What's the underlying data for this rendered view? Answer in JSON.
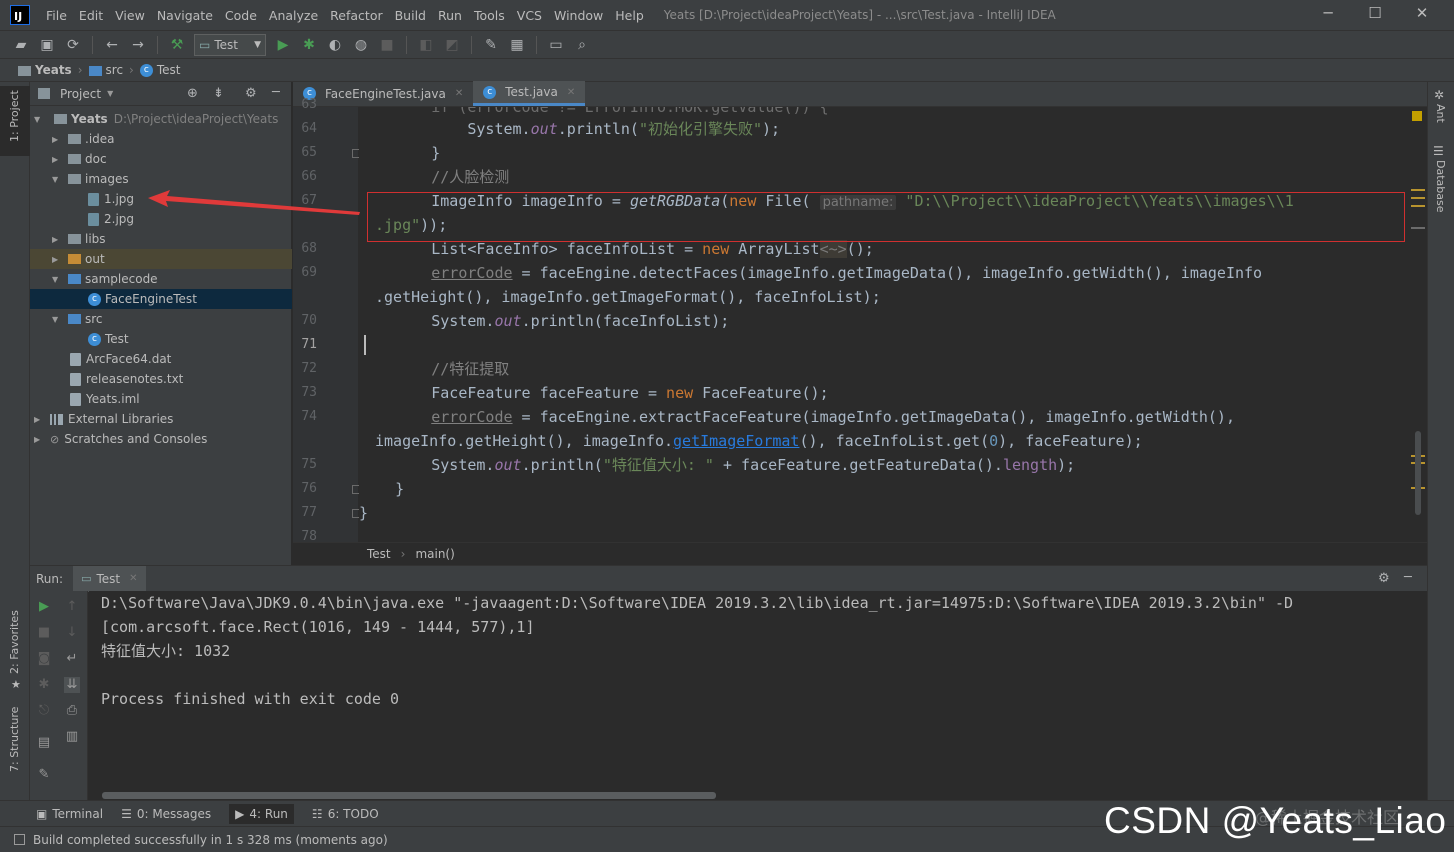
{
  "menubar": {
    "logo": "IJ",
    "items": [
      "File",
      "Edit",
      "View",
      "Navigate",
      "Code",
      "Analyze",
      "Refactor",
      "Build",
      "Run",
      "Tools",
      "VCS",
      "Window",
      "Help"
    ],
    "title": "Yeats [D:\\Project\\ideaProject\\Yeats] - ...\\src\\Test.java - IntelliJ IDEA",
    "minimize": "─",
    "maximize": "☐",
    "close": "✕"
  },
  "toolbar": {
    "run_config": "Test"
  },
  "breadcrumb": {
    "project": "Yeats",
    "folder": "src",
    "file": "Test"
  },
  "left_strip": {
    "project": "1: Project",
    "favorites": "2: Favorites",
    "structure": "7: Structure"
  },
  "right_strip": {
    "ant": "Ant",
    "database": "Database"
  },
  "project_panel": {
    "title": "Project",
    "root_name": "Yeats",
    "root_path": "D:\\Project\\ideaProject\\Yeats",
    "tree": {
      "idea": ".idea",
      "doc": "doc",
      "images": "images",
      "img1": "1.jpg",
      "img2": "2.jpg",
      "libs": "libs",
      "out": "out",
      "samplecode": "samplecode",
      "face_engine_test": "FaceEngineTest",
      "src": "src",
      "test": "Test",
      "arcface": "ArcFace64.dat",
      "release": "releasenotes.txt",
      "iml": "Yeats.iml",
      "ext_libs": "External Libraries",
      "scratches": "Scratches and Consoles"
    }
  },
  "editor": {
    "tabs": [
      "FaceEngineTest.java",
      "Test.java"
    ],
    "line_numbers": [
      "63",
      "64",
      "65",
      "66",
      "67",
      "68",
      "69",
      "70",
      "71",
      "72",
      "73",
      "74",
      "75",
      "76",
      "77",
      "78"
    ],
    "code": {
      "l64_a": "            System.",
      "l64_field": "out",
      "l64_b": ".println(",
      "l64_str": "\"初始化引擎失败\"",
      "l64_c": ");",
      "l65": "        }",
      "l66": "        //人脸检测",
      "l67_a": "        ImageInfo imageInfo = ",
      "l67_method": "getRGBData",
      "l67_kw": "new",
      "l67_b": " File( ",
      "l67_hint": "pathname:",
      "l67_str": " \"D:\\\\Project\\\\ideaProject\\\\Yeats\\\\images\\\\1",
      "l67_cont_str": ".jpg\"",
      "l67_cont": "));",
      "l68_a": "        List<FaceInfo> faceInfoList = ",
      "l68_kw": "new",
      "l68_b": " ArrayList",
      "l68_diamond": "<~>",
      "l68_c": "();",
      "l69_a": "        ",
      "l69_err": "errorCode",
      "l69_b": " = faceEngine.detectFaces(imageInfo.getImageData(), imageInfo.getWidth(), imageInfo",
      "l69_cont": ".getHeight(), imageInfo.getImageFormat(), faceInfoList);",
      "l70_a": "        System.",
      "l70_field": "out",
      "l70_b": ".println(faceInfoList);",
      "l72": "        //特征提取",
      "l73_a": "        FaceFeature faceFeature = ",
      "l73_kw": "new",
      "l73_b": " FaceFeature();",
      "l74_a": "        ",
      "l74_err": "errorCode",
      "l74_b": " = faceEngine.extractFaceFeature(imageInfo.getImageData(), imageInfo.getWidth(),",
      "l74_cont_a": "imageInfo.getHeight(), imageInfo.",
      "l74_link": "getImageFormat",
      "l74_cont_b": "(), faceInfoList.get(",
      "l74_num": "0",
      "l74_cont_c": "), faceFeature);",
      "l75_a": "        System.",
      "l75_field": "out",
      "l75_b": ".println(",
      "l75_str": "\"特征值大小: \"",
      "l75_c": " + faceFeature.getFeatureData().",
      "l75_len": "length",
      "l75_d": ");",
      "l76": "    }",
      "l77": "}"
    },
    "breadcrumb": [
      "Test",
      "main()"
    ]
  },
  "run_panel": {
    "label": "Run:",
    "tab": "Test",
    "console": [
      "D:\\Software\\Java\\JDK9.0.4\\bin\\java.exe \"-javaagent:D:\\Software\\IDEA 2019.3.2\\lib\\idea_rt.jar=14975:D:\\Software\\IDEA 2019.3.2\\bin\" -D",
      "[com.arcsoft.face.Rect(1016, 149 - 1444, 577),1]",
      "特征值大小: 1032",
      "",
      "Process finished with exit code 0"
    ]
  },
  "bottom_bar": {
    "terminal": "Terminal",
    "messages": "0: Messages",
    "run": "4: Run",
    "todo": "6: TODO"
  },
  "status": {
    "text": "Build completed successfully in 1 s 328 ms (moments ago)"
  },
  "watermark": {
    "text": "CSDN @Yeats_Liao",
    "faint": "@稀土掘金技术社区"
  },
  "colors": {
    "highlight_box": "#d03030",
    "arrow": "#e03a3a",
    "keyword": "#cc7832",
    "string": "#6a8759"
  }
}
